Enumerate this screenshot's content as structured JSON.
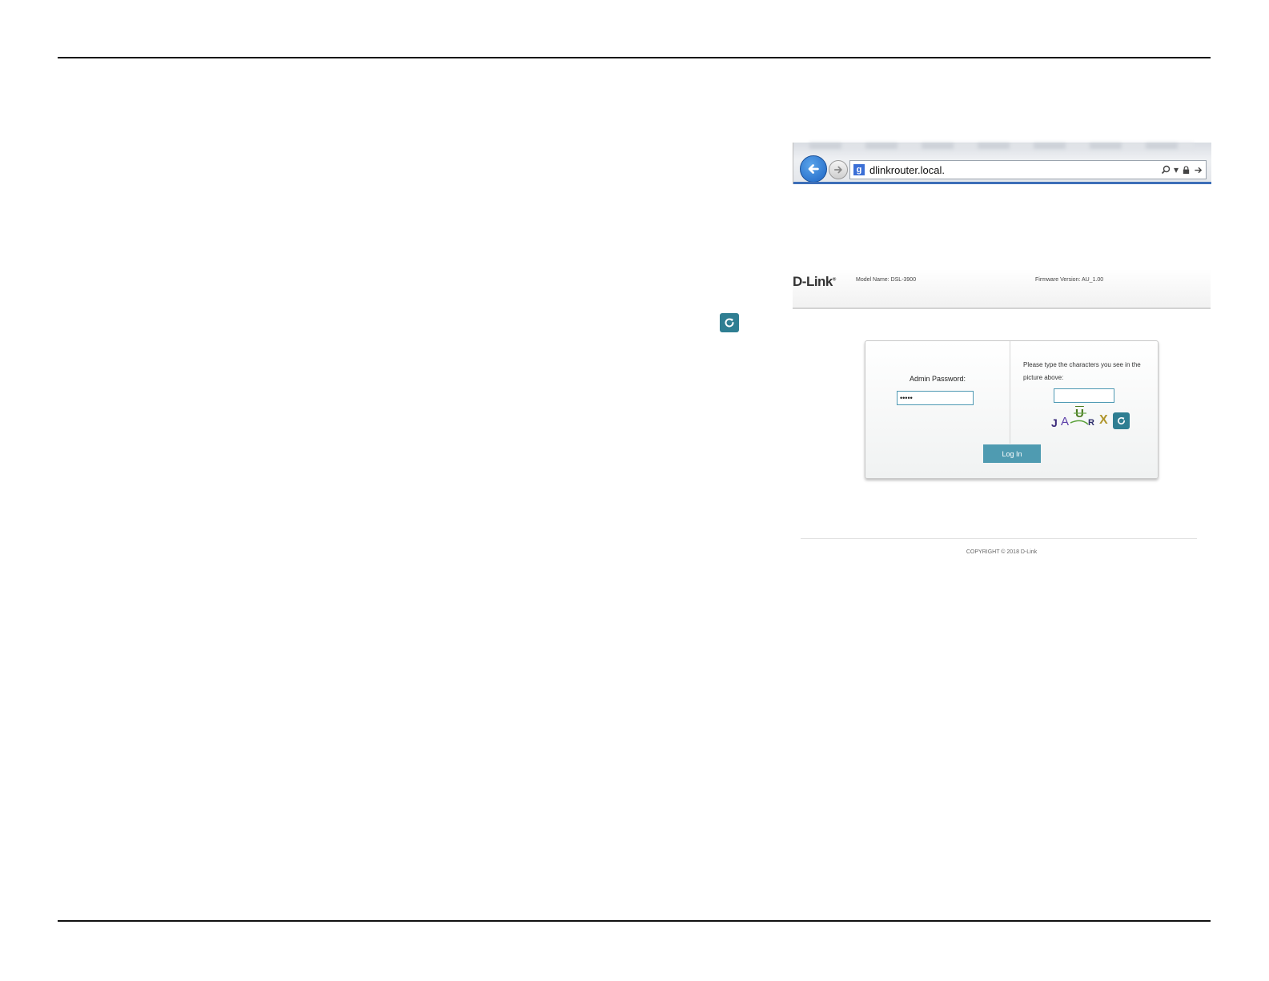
{
  "browser": {
    "address": "dlinkrouter.local.",
    "search_icon": "g-search-icon",
    "accent_color": "#1c64c4"
  },
  "router": {
    "logo": "D-Link",
    "model_name": "Model Name: DSL-3900",
    "firmware_version": "Firmware Version: AU_1.00"
  },
  "login": {
    "password_label": "Admin Password:",
    "password_value": "•••••",
    "captcha_prompt": "Please type the characters you see in the picture above:",
    "captcha_chars": [
      "J",
      "A",
      "U",
      "R",
      "X"
    ],
    "login_label": "Log In",
    "button_color": "#4f9bb1"
  },
  "footer": {
    "copyright": "COPYRIGHT © 2018 D-Link"
  },
  "icons": {
    "refresh": "refresh-icon",
    "back": "back-arrow-icon",
    "forward": "forward-arrow-icon"
  }
}
